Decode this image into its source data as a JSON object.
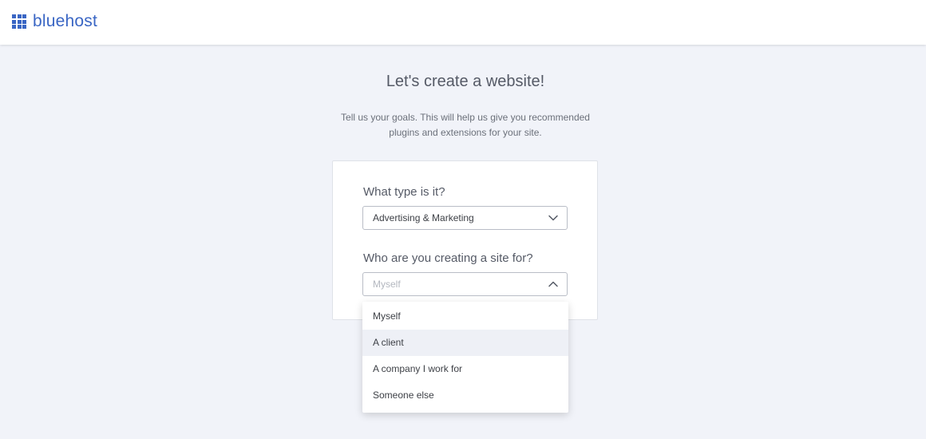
{
  "brand": {
    "name": "bluehost",
    "color": "#3a66c4"
  },
  "header": {
    "title": "Let's create a website!",
    "subtitle_line1": "Tell us your goals. This will help us give you recommended",
    "subtitle_line2": "plugins and extensions for your site."
  },
  "form": {
    "type_label": "What type is it?",
    "type_value": "Advertising & Marketing",
    "type_icon": "chevron-down-icon",
    "who_label": "Who are you creating a site for?",
    "who_placeholder": "Myself",
    "who_icon": "chevron-up-icon",
    "who_open": true
  },
  "dropdown": {
    "options": [
      "Myself",
      "A client",
      "A company I work for",
      "Someone else"
    ],
    "highlighted_index": 1
  }
}
